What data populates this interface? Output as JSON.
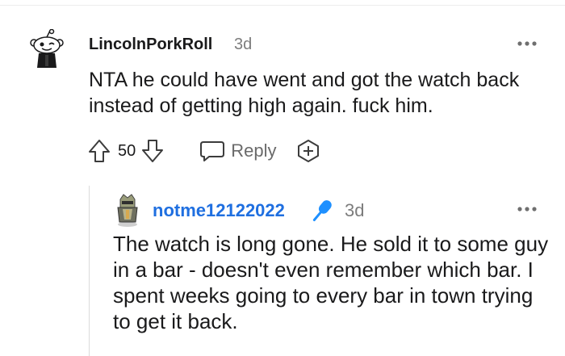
{
  "comment": {
    "username": "LincolnPorkRoll",
    "time": "3d",
    "body": "NTA he could have went and got the watch back instead of getting high again. fuck him.",
    "votes": "50",
    "reply_label": "Reply"
  },
  "reply": {
    "username": "notme12122022",
    "time": "3d",
    "body": "The watch is long gone. He sold it to some guy in a bar - doesn't even remember which bar. I spent weeks going to every bar in town trying to get it back."
  },
  "colors": {
    "username_reply": "#1f6fe0",
    "mic_badge": "#1e90ff",
    "muted_text": "#7c7c7c"
  },
  "icons": {
    "more": "more-horizontal-icon",
    "upvote": "upvote-arrow-icon",
    "downvote": "downvote-arrow-icon",
    "reply": "comment-bubble-icon",
    "award": "award-plus-icon",
    "mic": "microphone-icon"
  }
}
